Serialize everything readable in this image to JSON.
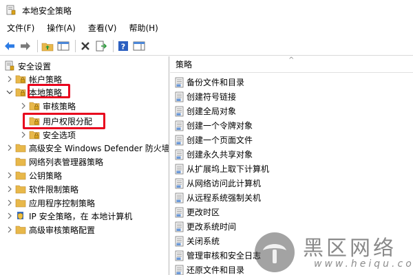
{
  "window": {
    "title": "本地安全策略"
  },
  "menu": [
    {
      "label": "文件(F)"
    },
    {
      "label": "操作(A)"
    },
    {
      "label": "查看(V)"
    },
    {
      "label": "帮助(H)"
    }
  ],
  "tree": {
    "root": "安全设置",
    "items": [
      {
        "label": "帐户策略"
      },
      {
        "label": "本地策略"
      },
      {
        "label": "审核策略"
      },
      {
        "label": "用户权限分配"
      },
      {
        "label": "安全选项"
      },
      {
        "label": "高级安全 Windows Defender 防火墙"
      },
      {
        "label": "网络列表管理器策略"
      },
      {
        "label": "公钥策略"
      },
      {
        "label": "软件限制策略"
      },
      {
        "label": "应用程序控制策略"
      },
      {
        "label": "IP 安全策略，在 本地计算机"
      },
      {
        "label": "高级审核策略配置"
      }
    ]
  },
  "list": {
    "header": "策略",
    "items": [
      "备份文件和目录",
      "创建符号链接",
      "创建全局对象",
      "创建一个令牌对象",
      "创建一个页面文件",
      "创建永久共享对象",
      "从扩展坞上取下计算机",
      "从网络访问此计算机",
      "从远程系统强制关机",
      "更改时区",
      "更改系统时间",
      "关闭系统",
      "管理审核和安全日志",
      "还原文件和目录"
    ]
  },
  "watermark": {
    "text": "黑区网络",
    "url": "www.heiqu.com"
  },
  "colors": {
    "highlight": "#e8001c",
    "folder": "#e8b84a",
    "accent": "#1f6fd0"
  }
}
